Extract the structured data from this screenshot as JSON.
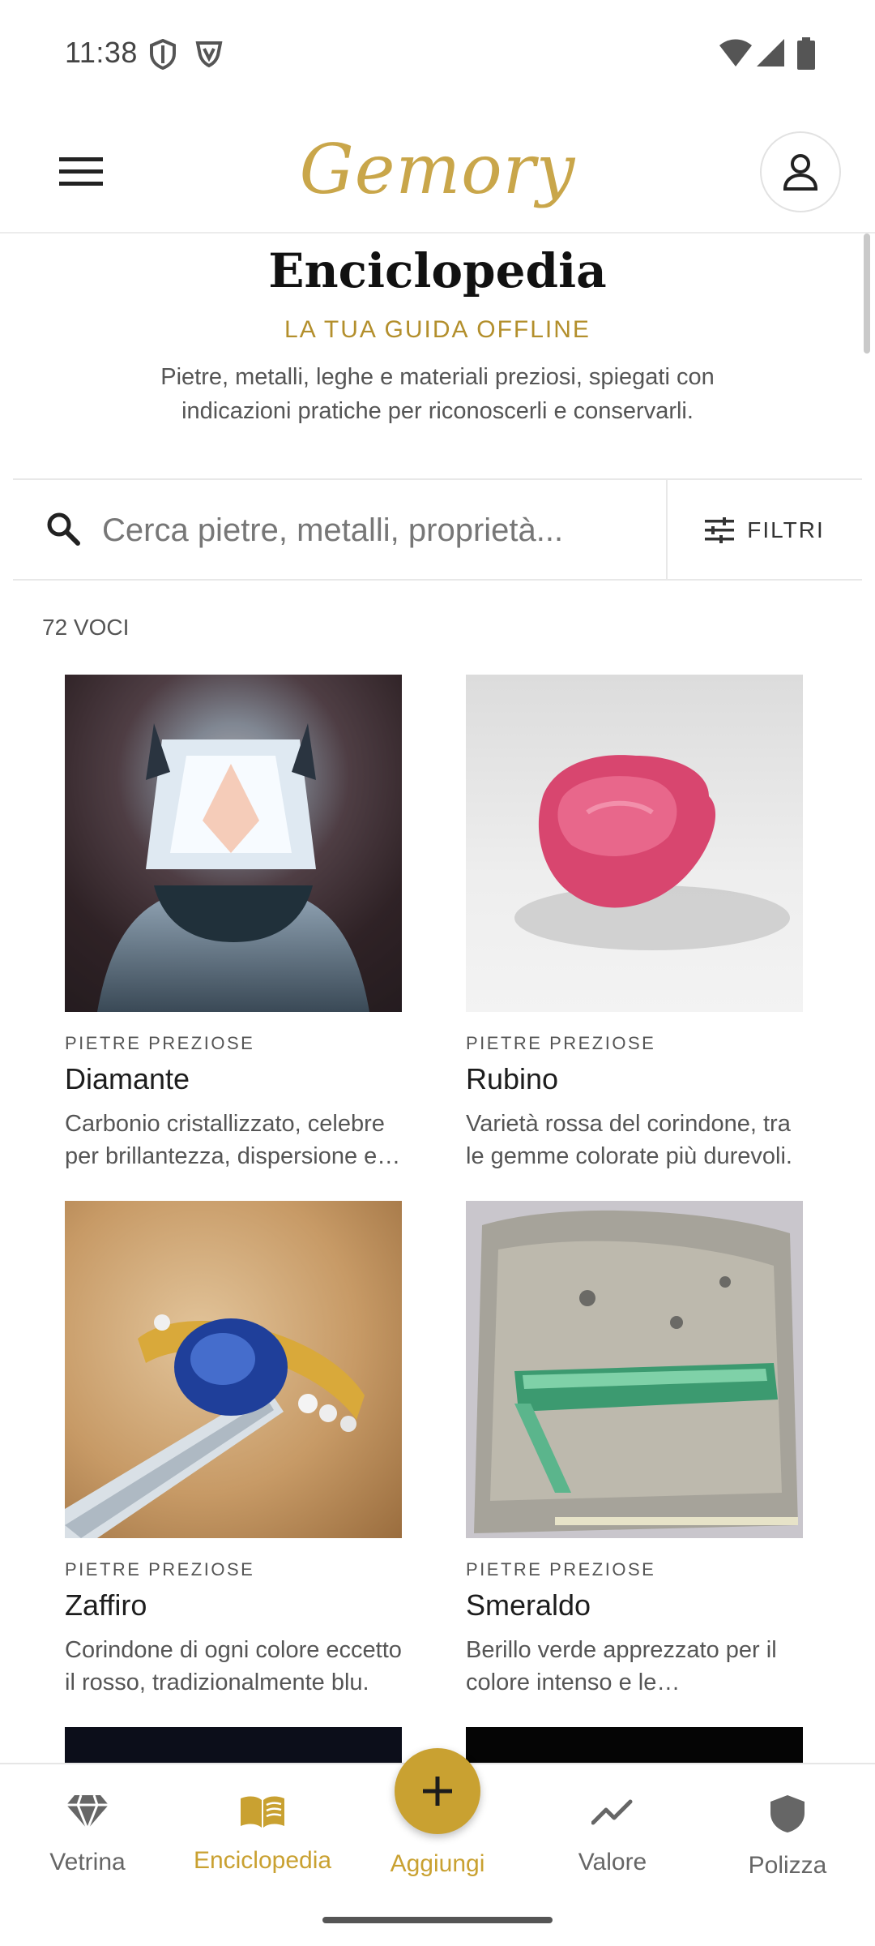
{
  "status_bar": {
    "time": "11:38"
  },
  "app_bar": {
    "logo_text": "Gemory"
  },
  "header": {
    "title": "Enciclopedia",
    "subtitle": "LA TUA GUIDA OFFLINE",
    "description": "Pietre, metalli, leghe e materiali preziosi, spiegati con indicazioni pratiche per riconoscerli e conservarli."
  },
  "search": {
    "placeholder": "Cerca pietre, metalli, proprietà...",
    "value": ""
  },
  "filters": {
    "label": "FILTRI"
  },
  "count_label": "72 VOCI",
  "cards": [
    {
      "category": "PIETRE PREZIOSE",
      "name": "Diamante",
      "description": "Carbonio cristallizzato, celebre per brillantezza, dispersione e durezza."
    },
    {
      "category": "PIETRE PREZIOSE",
      "name": "Rubino",
      "description": "Varietà rossa del corindone, tra le gemme colorate più durevoli."
    },
    {
      "category": "PIETRE PREZIOSE",
      "name": "Zaffiro",
      "description": "Corindone di ogni colore eccetto il rosso, tradizionalmente blu."
    },
    {
      "category": "PIETRE PREZIOSE",
      "name": "Smeraldo",
      "description": "Berillo verde apprezzato per il colore intenso e le caratteristiche inclusioni."
    }
  ],
  "bottom_nav": {
    "items": [
      {
        "label": "Vetrina",
        "icon": "diamond-icon"
      },
      {
        "label": "Enciclopedia",
        "icon": "book-icon",
        "active": true
      },
      {
        "label": "Aggiungi",
        "icon": "plus-icon"
      },
      {
        "label": "Valore",
        "icon": "trend-icon"
      },
      {
        "label": "Polizza",
        "icon": "shield-icon"
      }
    ]
  },
  "colors": {
    "accent": "#c9a131",
    "gold_logo": "#c9a64a"
  }
}
